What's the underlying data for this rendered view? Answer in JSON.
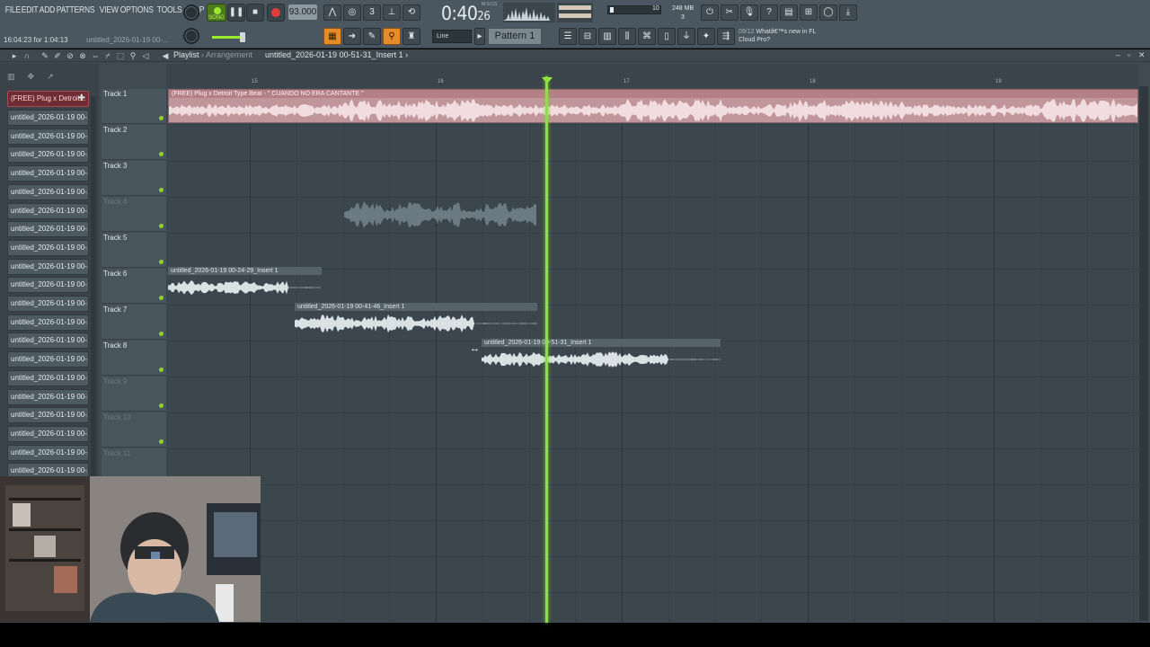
{
  "menu": [
    "FILE",
    "EDIT",
    "ADD",
    "PATTERNS",
    "VIEW",
    "OPTIONS",
    "TOOLS",
    "HELP"
  ],
  "hint": "16:04:23 for 1:04:13",
  "hint_clip": "untitled_2026-01-19 00-...",
  "song_label": "SONG",
  "tempo": "93.000",
  "time_main": "0:40",
  "time_sub": "26",
  "time_label": "M:S:CS",
  "cpu": {
    "v1": "10",
    "v2": "248 MB",
    "v3": "3"
  },
  "snap": "Line",
  "pattern": "Pattern 1",
  "news": {
    "num": "09/12",
    "text": "Whatâ€™s new in FL Cloud Pro?"
  },
  "playlist": {
    "title": "Playlist",
    "sep": " › ",
    "sub": "Arrangement",
    "clip_name": "untitled_2026-01-19 00-51-31_Insert 1 ›"
  },
  "ruler": [
    "15",
    "16",
    "17",
    "18",
    "19"
  ],
  "sidebar": {
    "selected": "(FREE) Plug x Detroit...",
    "items": [
      "untitled_2026-01-19 00-...",
      "untitled_2026-01-19 00-...",
      "untitled_2026-01-19 00-...",
      "untitled_2026-01-19 00-...",
      "untitled_2026-01-19 00-...",
      "untitled_2026-01-19 00-...",
      "untitled_2026-01-19 00-...",
      "untitled_2026-01-19 00-...",
      "untitled_2026-01-19 00-...",
      "untitled_2026-01-19 00-...",
      "untitled_2026-01-19 00-...",
      "untitled_2026-01-19 00-...",
      "untitled_2026-01-19 00-...",
      "untitled_2026-01-19 00-...",
      "untitled_2026-01-19 00-...",
      "untitled_2026-01-19 00-...",
      "untitled_2026-01-19 00-...",
      "untitled_2026-01-19 00-...",
      "untitled_2026-01-19 00-...",
      "untitled_2026-01-19 00-..."
    ]
  },
  "tracks": [
    {
      "name": "Track 1",
      "muted": false
    },
    {
      "name": "Track 2",
      "muted": false
    },
    {
      "name": "Track 3",
      "muted": false
    },
    {
      "name": "Track 4",
      "muted": true
    },
    {
      "name": "Track 5",
      "muted": false
    },
    {
      "name": "Track 6",
      "muted": false
    },
    {
      "name": "Track 7",
      "muted": false
    },
    {
      "name": "Track 8",
      "muted": false
    },
    {
      "name": "Track 9",
      "muted": true
    },
    {
      "name": "Track 10",
      "muted": true
    },
    {
      "name": "Track 11",
      "muted": true
    }
  ],
  "clips": {
    "main": "(FREE) Plug x Detroit Type Beat - \" CUANDO NO ERA CANTANTE \"",
    "c6": "untitled_2026-01-19 00-24-29_Insert 1",
    "c7": "untitled_2026-01-19 00-41-46_Insert 1",
    "c8": "untitled_2026-01-19 00-51-31_Insert 1"
  },
  "colors": {
    "accent": "#8fe03a",
    "main_clip": "#c1969b",
    "orange": "#e58b29",
    "record": "#e23b3b"
  }
}
